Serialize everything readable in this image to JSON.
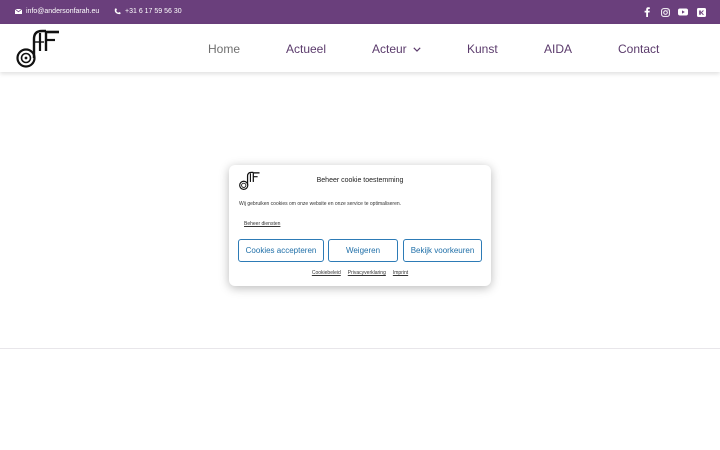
{
  "topbar": {
    "background": "#6a3f7c",
    "email": "info@andersonfarah.eu",
    "phone": "+31 6 17 59 56 30",
    "social_icons": [
      "facebook-icon",
      "instagram-icon",
      "youtube-icon",
      "vk-icon"
    ]
  },
  "header": {
    "logo_icon": "af-monogram-logo",
    "nav": [
      {
        "label": "Home",
        "active": true
      },
      {
        "label": "Actueel"
      },
      {
        "label": "Acteur",
        "has_dropdown": true
      },
      {
        "label": "Kunst"
      },
      {
        "label": "AIDA"
      },
      {
        "label": "Contact"
      }
    ]
  },
  "cookie_modal": {
    "title": "Beheer cookie toestemming",
    "message": "Wij gebruiken cookies om onze website en onze service te optimaliseren.",
    "manage_link": "Beheer diensten",
    "buttons": {
      "accept": "Cookies accepteren",
      "deny": "Weigeren",
      "preferences": "Bekijk voorkeuren"
    },
    "links": [
      "Cookiebeleid",
      "Privacyverklaring",
      "Imprint"
    ],
    "accent": "#2d7bb6"
  }
}
